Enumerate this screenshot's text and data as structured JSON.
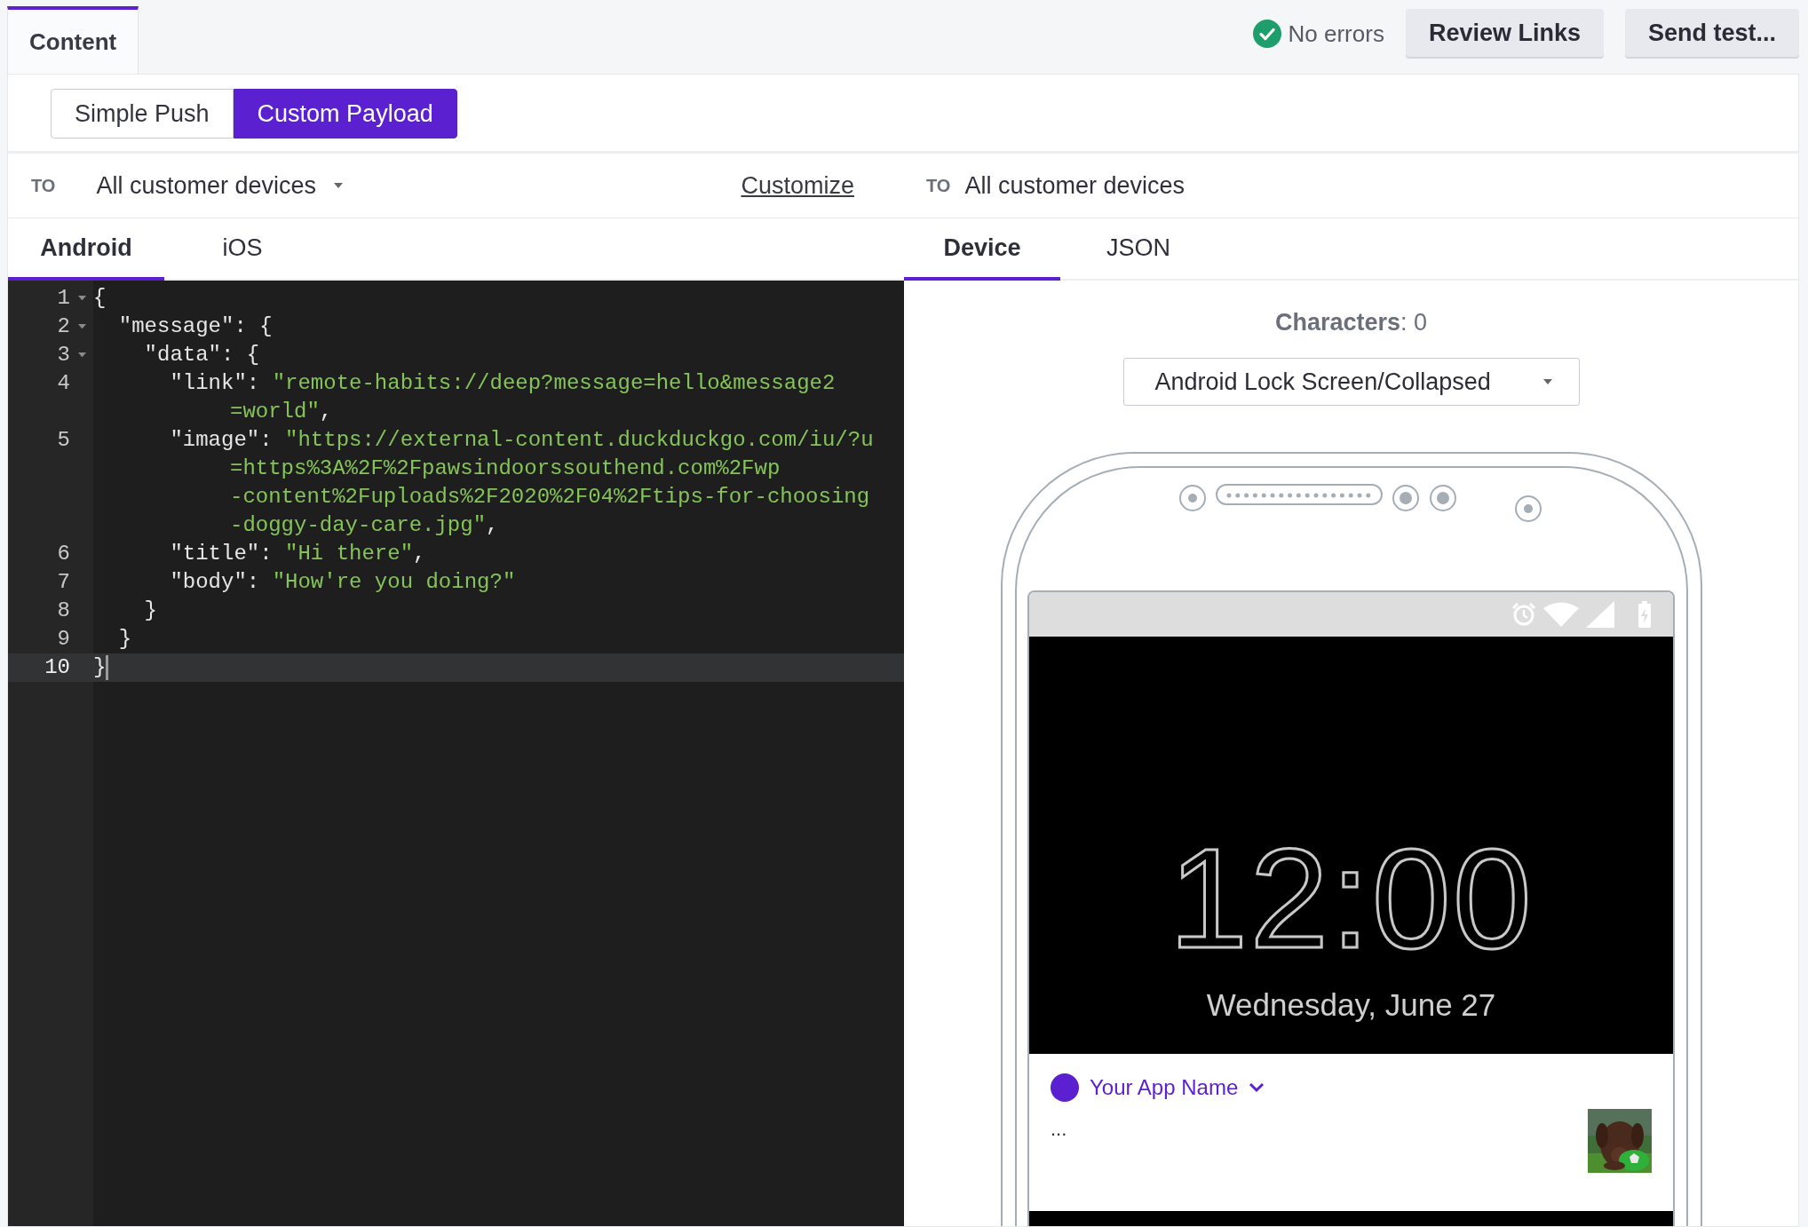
{
  "tabs": [
    {
      "label": "Content",
      "selected": true
    }
  ],
  "status": {
    "label": "No errors",
    "ok": true
  },
  "actions": [
    "Review Links",
    "Send test..."
  ],
  "modes": [
    {
      "label": "Simple Push",
      "selected": false
    },
    {
      "label": "Custom Payload",
      "selected": true
    }
  ],
  "audience": {
    "to_label": "TO",
    "value": "All customer devices",
    "customize": "Customize",
    "preview_to_label": "TO",
    "preview_value": "All customer devices"
  },
  "platform_tabs": [
    {
      "label": "Android",
      "selected": true
    },
    {
      "label": "iOS",
      "selected": false
    }
  ],
  "preview_tabs": [
    {
      "label": "Device",
      "selected": true
    },
    {
      "label": "JSON",
      "selected": false
    }
  ],
  "editor": {
    "lines": [
      {
        "number": "1",
        "fold": true,
        "active": false,
        "tokens": [
          {
            "kind": "punct",
            "text": "{"
          }
        ]
      },
      {
        "number": "2",
        "fold": true,
        "active": false,
        "tokens": [
          {
            "kind": "key",
            "text": "  \"message\""
          },
          {
            "kind": "punct",
            "text": ": {"
          }
        ]
      },
      {
        "number": "3",
        "fold": true,
        "active": false,
        "tokens": [
          {
            "kind": "key",
            "text": "    \"data\""
          },
          {
            "kind": "punct",
            "text": ": {"
          }
        ]
      },
      {
        "number": "4",
        "fold": false,
        "active": false,
        "tokens": [
          {
            "kind": "key",
            "text": "      \"link\""
          },
          {
            "kind": "punct",
            "text": ": "
          },
          {
            "kind": "string",
            "text": "\"remote-habits://deep?message=hello&message2"
          },
          {
            "kind": "string",
            "wrap": true,
            "text": "=world\""
          },
          {
            "kind": "punct",
            "text": ","
          }
        ]
      },
      {
        "number": "5",
        "fold": false,
        "active": false,
        "tokens": [
          {
            "kind": "key",
            "text": "      \"image\""
          },
          {
            "kind": "punct",
            "text": ": "
          },
          {
            "kind": "string",
            "text": "\"https://external-content.duckduckgo.com/iu/?u"
          },
          {
            "kind": "string",
            "wrap": true,
            "text": "=https%3A%2F%2Fpawsindoorssouthend.com%2Fwp"
          },
          {
            "kind": "string",
            "wrap": true,
            "text": "-content%2Fuploads%2F2020%2F04%2Ftips-for-choosing"
          },
          {
            "kind": "string",
            "wrap": true,
            "text": "-doggy-day-care.jpg\""
          },
          {
            "kind": "punct",
            "text": ","
          }
        ]
      },
      {
        "number": "6",
        "fold": false,
        "active": false,
        "tokens": [
          {
            "kind": "key",
            "text": "      \"title\""
          },
          {
            "kind": "punct",
            "text": ": "
          },
          {
            "kind": "string",
            "text": "\"Hi there\""
          },
          {
            "kind": "punct",
            "text": ","
          }
        ]
      },
      {
        "number": "7",
        "fold": false,
        "active": false,
        "tokens": [
          {
            "kind": "key",
            "text": "      \"body\""
          },
          {
            "kind": "punct",
            "text": ": "
          },
          {
            "kind": "string",
            "text": "\"How're you doing?\""
          }
        ]
      },
      {
        "number": "8",
        "fold": false,
        "active": false,
        "tokens": [
          {
            "kind": "punct",
            "text": "    }"
          }
        ]
      },
      {
        "number": "9",
        "fold": false,
        "active": false,
        "tokens": [
          {
            "kind": "punct",
            "text": "  }"
          }
        ]
      },
      {
        "number": "10",
        "fold": false,
        "active": true,
        "tokens": [
          {
            "kind": "punct",
            "text": "}"
          }
        ]
      }
    ]
  },
  "preview": {
    "characters": "**Characters**: 0",
    "view": "Android Lock Screen/Collapsed",
    "clock": "12:00",
    "date": "Wednesday, June 27",
    "app_name": "Your App Name",
    "body": "..."
  }
}
